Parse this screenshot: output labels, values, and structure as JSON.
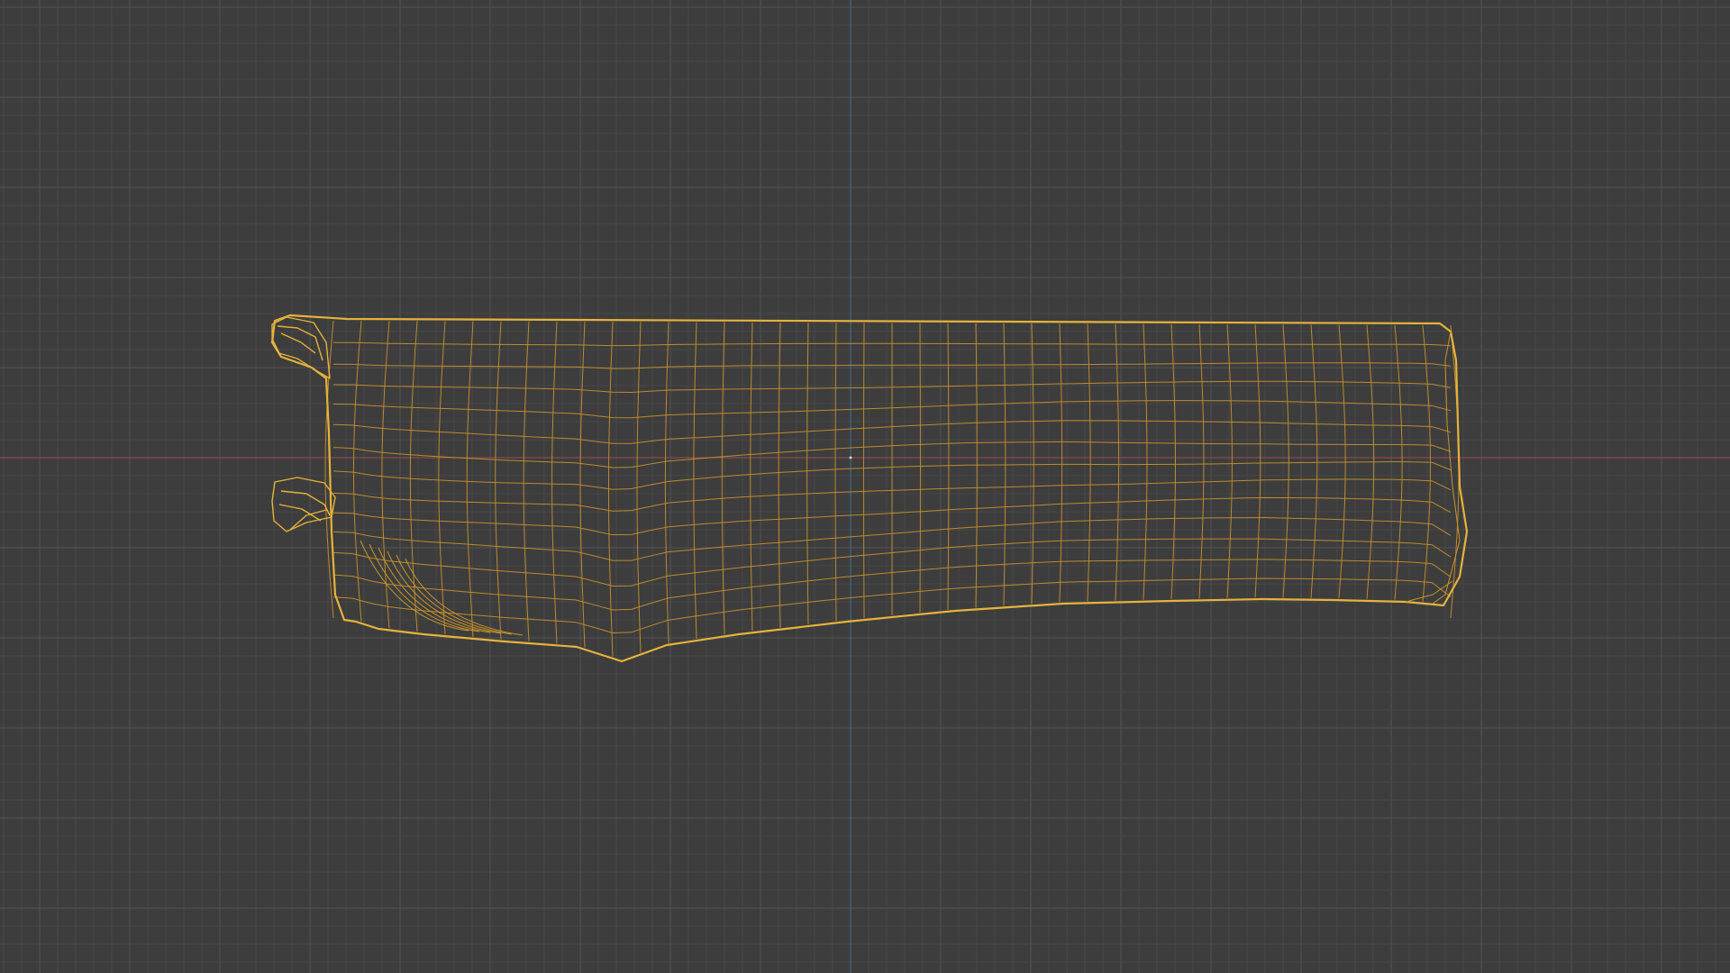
{
  "viewport": {
    "view": "orthographic-wireframe",
    "grid_visible": true,
    "colors": {
      "background": "#3d3d3d",
      "grid_minor": "#484848",
      "grid_major": "#525252",
      "axis_x": "#8a4a4f",
      "axis_y": "#3f6a8c",
      "wireframe": "#c8942c",
      "wireframe_outline": "#e7b23c"
    }
  },
  "object": {
    "display": "wireframe",
    "selected": true
  }
}
